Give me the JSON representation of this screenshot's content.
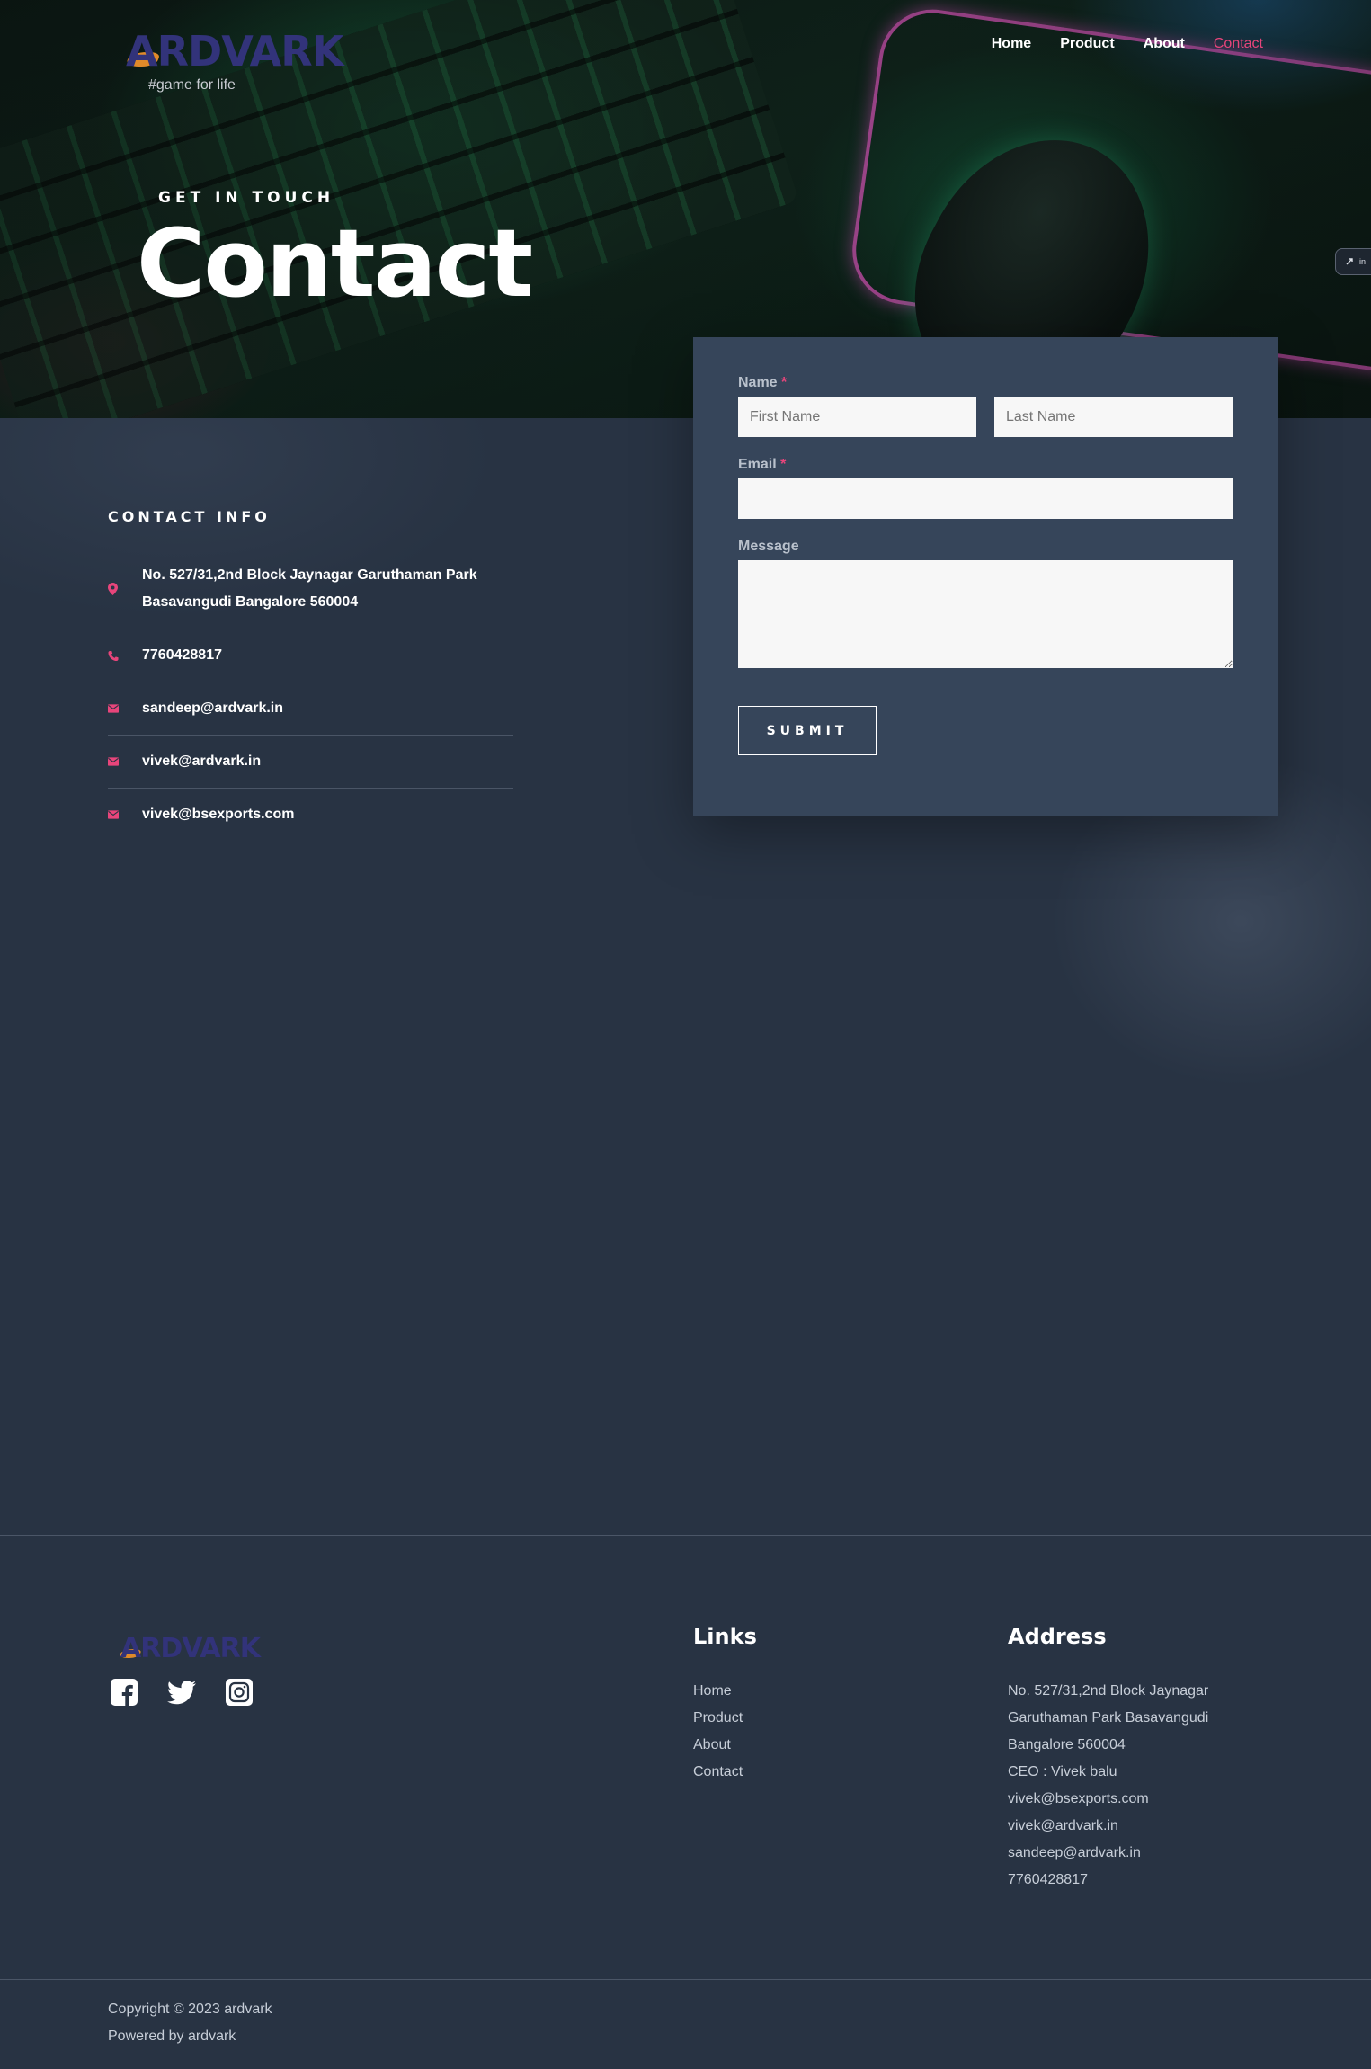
{
  "brand": {
    "logo_text": "ARDVARK",
    "tagline": "#game for life",
    "accent_color": "#e8457b",
    "logo_color": "#32337a"
  },
  "nav": {
    "items": [
      {
        "label": "Home"
      },
      {
        "label": "Product"
      },
      {
        "label": "About"
      },
      {
        "label": "Contact",
        "active": true
      }
    ]
  },
  "hero": {
    "eyebrow": "GET IN TOUCH",
    "title": "Contact",
    "side_badge_text": "in"
  },
  "contact_info": {
    "heading": "CONTACT INFO",
    "items": [
      {
        "icon": "map-pin-icon",
        "lines": [
          "No. 527/31,2nd Block Jaynagar Garuthaman Park",
          "Basavangudi Bangalore 560004"
        ]
      },
      {
        "icon": "phone-icon",
        "lines": [
          "7760428817"
        ]
      },
      {
        "icon": "envelope-icon",
        "lines": [
          "sandeep@ardvark.in"
        ]
      },
      {
        "icon": "envelope-icon",
        "lines": [
          "vivek@ardvark.in"
        ]
      },
      {
        "icon": "envelope-icon",
        "lines": [
          "vivek@bsexports.com"
        ]
      }
    ]
  },
  "form": {
    "name_label": "Name",
    "required_mark": "*",
    "first_name_placeholder": "First Name",
    "first_name_value": "",
    "last_name_placeholder": "Last Name",
    "last_name_value": "",
    "email_label": "Email",
    "email_value": "",
    "message_label": "Message",
    "message_value": "",
    "submit_label": "SUBMIT"
  },
  "footer": {
    "logo_text": "ARDVARK",
    "socials": [
      {
        "icon": "facebook-icon"
      },
      {
        "icon": "twitter-icon"
      },
      {
        "icon": "instagram-icon"
      }
    ],
    "links_title": "Links",
    "links": [
      "Home",
      "Product",
      "About",
      "Contact"
    ],
    "address_title": "Address",
    "address_lines": [
      "No. 527/31,2nd Block Jaynagar",
      "Garuthaman Park Basavangudi",
      "Bangalore 560004",
      "CEO : Vivek balu",
      "vivek@bsexports.com",
      "vivek@ardvark.in",
      "sandeep@ardvark.in",
      "7760428817"
    ],
    "copyright": "Copyright © 2023 ardvark",
    "powered_by": "Powered by ardvark"
  }
}
